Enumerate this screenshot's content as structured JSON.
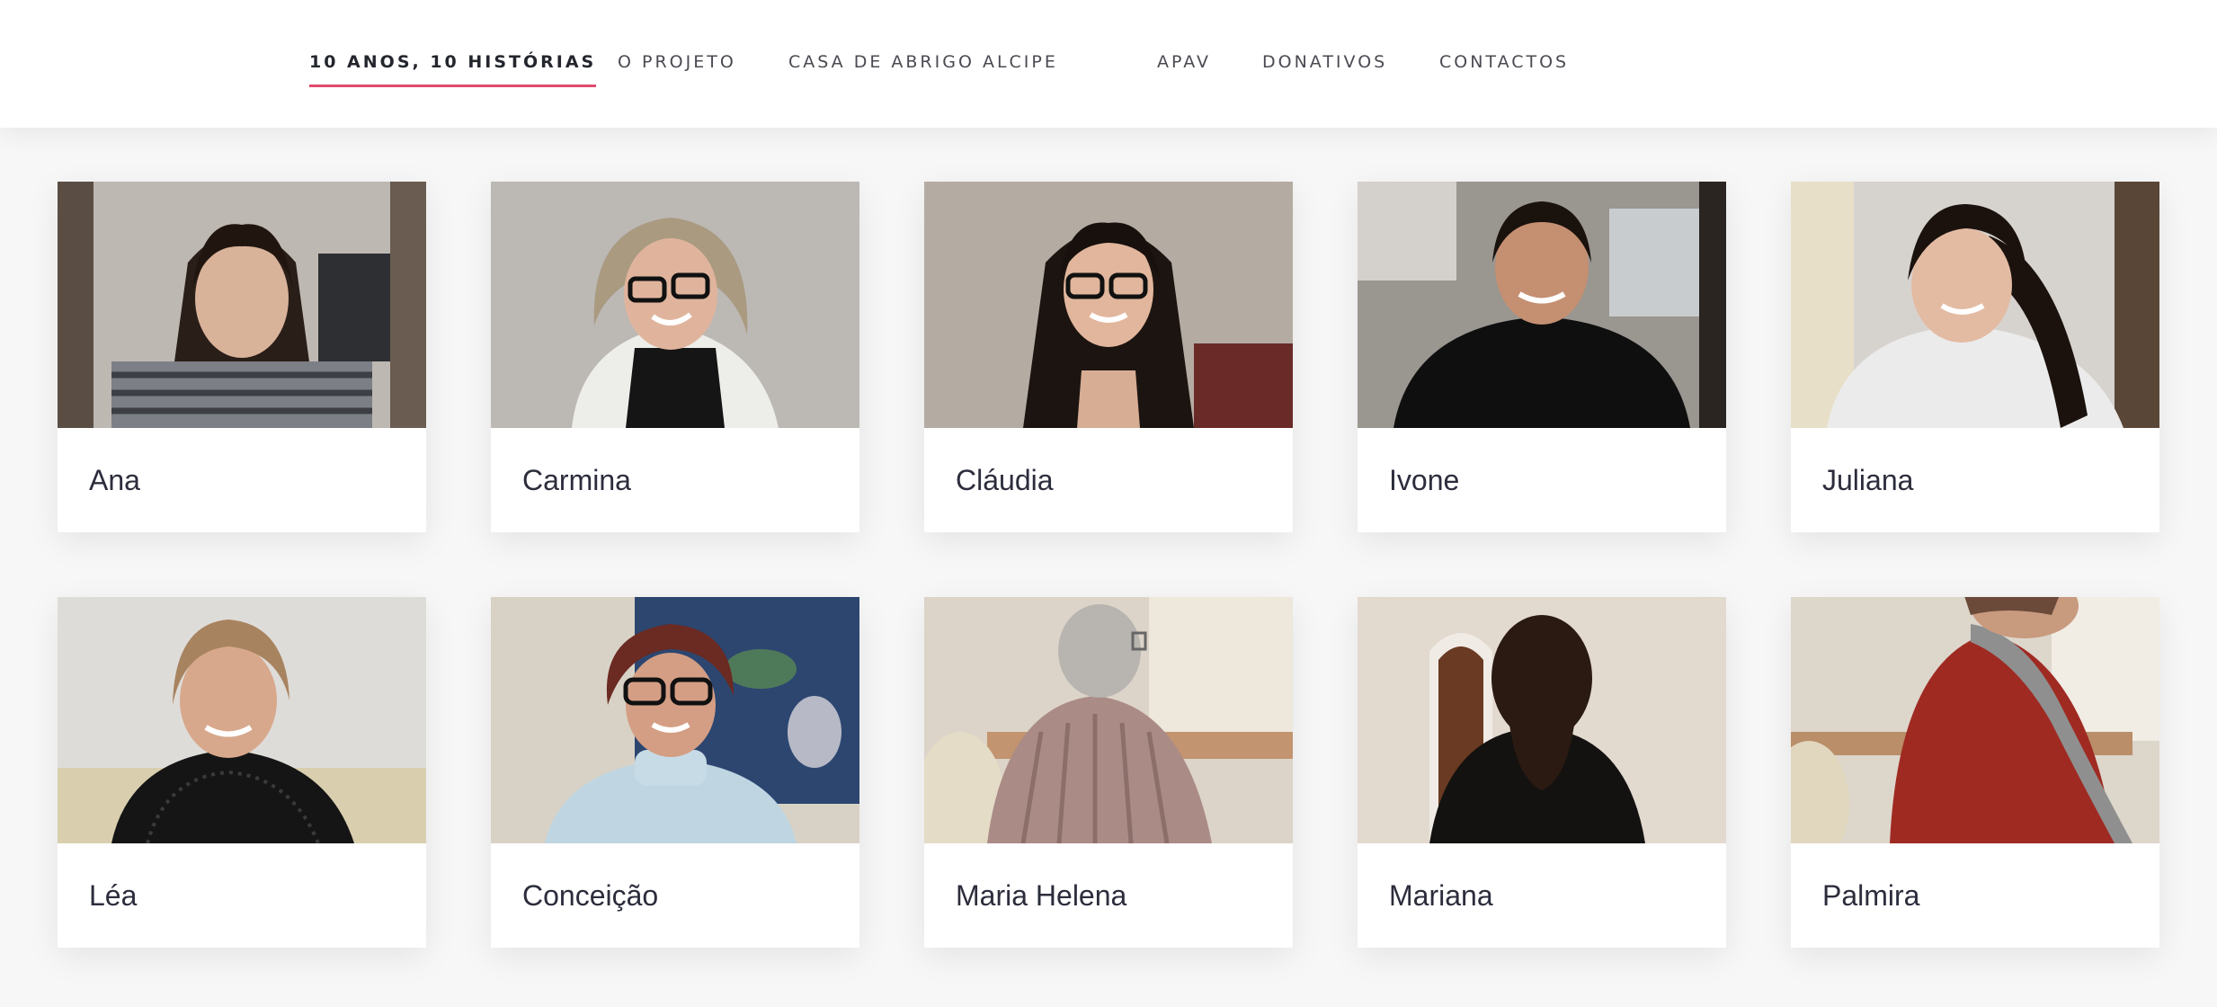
{
  "nav": {
    "items": [
      {
        "label": "10 ANOS, 10 HISTÓRIAS",
        "active": true
      },
      {
        "label": "O PROJETO",
        "active": false
      },
      {
        "label": "CASA DE ABRIGO ALCIPE",
        "active": false
      },
      {
        "label": "APAV",
        "active": false
      },
      {
        "label": "DONATIVOS",
        "active": false
      },
      {
        "label": "CONTACTOS",
        "active": false
      }
    ],
    "accent_color": "#e04a6e"
  },
  "stories": [
    {
      "name": "Ana"
    },
    {
      "name": "Carmina"
    },
    {
      "name": "Cláudia"
    },
    {
      "name": "Ivone"
    },
    {
      "name": "Juliana"
    },
    {
      "name": "Léa"
    },
    {
      "name": "Conceição"
    },
    {
      "name": "Maria Helena"
    },
    {
      "name": "Mariana"
    },
    {
      "name": "Palmira"
    }
  ]
}
